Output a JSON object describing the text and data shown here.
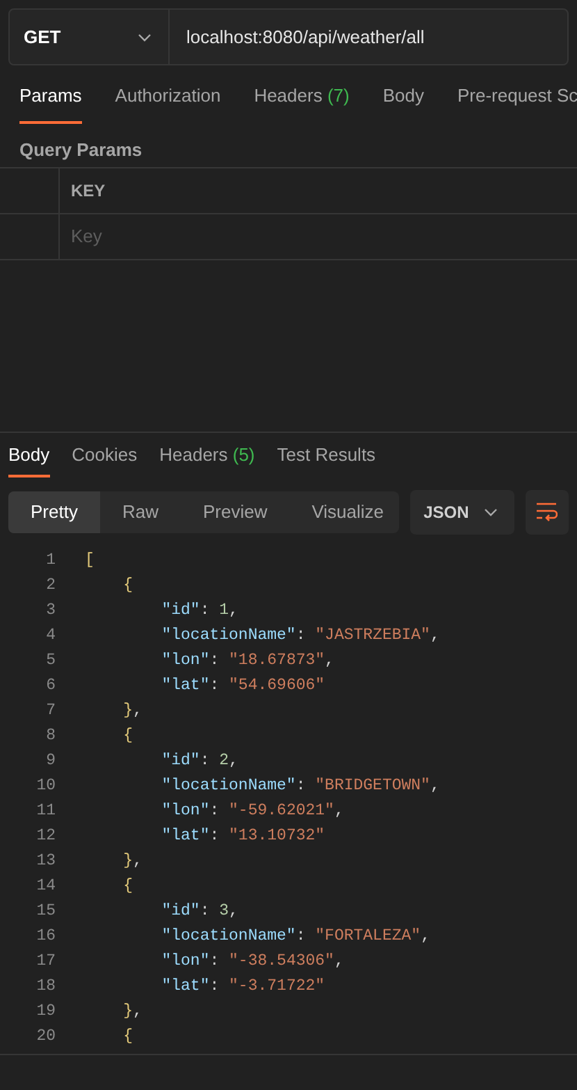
{
  "request": {
    "method": "GET",
    "url": "localhost:8080/api/weather/all"
  },
  "request_tabs": [
    {
      "label": "Params",
      "selected": true
    },
    {
      "label": "Authorization",
      "selected": false
    },
    {
      "label": "Headers",
      "count": "(7)",
      "selected": false
    },
    {
      "label": "Body",
      "selected": false
    },
    {
      "label": "Pre-request Sc",
      "selected": false
    }
  ],
  "query_params": {
    "title": "Query Params",
    "columns": [
      "KEY"
    ],
    "placeholder": "Key"
  },
  "response_tabs": [
    {
      "label": "Body",
      "selected": true
    },
    {
      "label": "Cookies",
      "selected": false
    },
    {
      "label": "Headers",
      "count": "(5)",
      "selected": false
    },
    {
      "label": "Test Results",
      "selected": false
    }
  ],
  "view_modes": [
    {
      "label": "Pretty",
      "selected": true
    },
    {
      "label": "Raw",
      "selected": false
    },
    {
      "label": "Preview",
      "selected": false
    },
    {
      "label": "Visualize",
      "selected": false
    }
  ],
  "format": "JSON",
  "code_lines": [
    {
      "number": "1",
      "tokens": [
        {
          "kind": "bracket",
          "text": "["
        }
      ]
    },
    {
      "number": "2",
      "tokens": [
        {
          "kind": "bracket",
          "text": "    {"
        }
      ]
    },
    {
      "number": "3",
      "tokens": [
        {
          "kind": "key",
          "text": "        \"id\""
        },
        {
          "kind": "punct",
          "text": ": "
        },
        {
          "kind": "number",
          "text": "1"
        },
        {
          "kind": "punct",
          "text": ","
        }
      ]
    },
    {
      "number": "4",
      "tokens": [
        {
          "kind": "key",
          "text": "        \"locationName\""
        },
        {
          "kind": "punct",
          "text": ": "
        },
        {
          "kind": "string",
          "text": "\"JASTRZEBIA\""
        },
        {
          "kind": "punct",
          "text": ","
        }
      ]
    },
    {
      "number": "5",
      "tokens": [
        {
          "kind": "key",
          "text": "        \"lon\""
        },
        {
          "kind": "punct",
          "text": ": "
        },
        {
          "kind": "string",
          "text": "\"18.67873\""
        },
        {
          "kind": "punct",
          "text": ","
        }
      ]
    },
    {
      "number": "6",
      "tokens": [
        {
          "kind": "key",
          "text": "        \"lat\""
        },
        {
          "kind": "punct",
          "text": ": "
        },
        {
          "kind": "string",
          "text": "\"54.69606\""
        }
      ]
    },
    {
      "number": "7",
      "tokens": [
        {
          "kind": "bracket",
          "text": "    }"
        },
        {
          "kind": "punct",
          "text": ","
        }
      ]
    },
    {
      "number": "8",
      "tokens": [
        {
          "kind": "bracket",
          "text": "    {"
        }
      ]
    },
    {
      "number": "9",
      "tokens": [
        {
          "kind": "key",
          "text": "        \"id\""
        },
        {
          "kind": "punct",
          "text": ": "
        },
        {
          "kind": "number",
          "text": "2"
        },
        {
          "kind": "punct",
          "text": ","
        }
      ]
    },
    {
      "number": "10",
      "tokens": [
        {
          "kind": "key",
          "text": "        \"locationName\""
        },
        {
          "kind": "punct",
          "text": ": "
        },
        {
          "kind": "string",
          "text": "\"BRIDGETOWN\""
        },
        {
          "kind": "punct",
          "text": ","
        }
      ]
    },
    {
      "number": "11",
      "tokens": [
        {
          "kind": "key",
          "text": "        \"lon\""
        },
        {
          "kind": "punct",
          "text": ": "
        },
        {
          "kind": "string",
          "text": "\"-59.62021\""
        },
        {
          "kind": "punct",
          "text": ","
        }
      ]
    },
    {
      "number": "12",
      "tokens": [
        {
          "kind": "key",
          "text": "        \"lat\""
        },
        {
          "kind": "punct",
          "text": ": "
        },
        {
          "kind": "string",
          "text": "\"13.10732\""
        }
      ]
    },
    {
      "number": "13",
      "tokens": [
        {
          "kind": "bracket",
          "text": "    }"
        },
        {
          "kind": "punct",
          "text": ","
        }
      ]
    },
    {
      "number": "14",
      "tokens": [
        {
          "kind": "bracket",
          "text": "    {"
        }
      ]
    },
    {
      "number": "15",
      "tokens": [
        {
          "kind": "key",
          "text": "        \"id\""
        },
        {
          "kind": "punct",
          "text": ": "
        },
        {
          "kind": "number",
          "text": "3"
        },
        {
          "kind": "punct",
          "text": ","
        }
      ]
    },
    {
      "number": "16",
      "tokens": [
        {
          "kind": "key",
          "text": "        \"locationName\""
        },
        {
          "kind": "punct",
          "text": ": "
        },
        {
          "kind": "string",
          "text": "\"FORTALEZA\""
        },
        {
          "kind": "punct",
          "text": ","
        }
      ]
    },
    {
      "number": "17",
      "tokens": [
        {
          "kind": "key",
          "text": "        \"lon\""
        },
        {
          "kind": "punct",
          "text": ": "
        },
        {
          "kind": "string",
          "text": "\"-38.54306\""
        },
        {
          "kind": "punct",
          "text": ","
        }
      ]
    },
    {
      "number": "18",
      "tokens": [
        {
          "kind": "key",
          "text": "        \"lat\""
        },
        {
          "kind": "punct",
          "text": ": "
        },
        {
          "kind": "string",
          "text": "\"-3.71722\""
        }
      ]
    },
    {
      "number": "19",
      "tokens": [
        {
          "kind": "bracket",
          "text": "    }"
        },
        {
          "kind": "punct",
          "text": ","
        }
      ]
    },
    {
      "number": "20",
      "tokens": [
        {
          "kind": "bracket",
          "text": "    {"
        }
      ]
    }
  ]
}
